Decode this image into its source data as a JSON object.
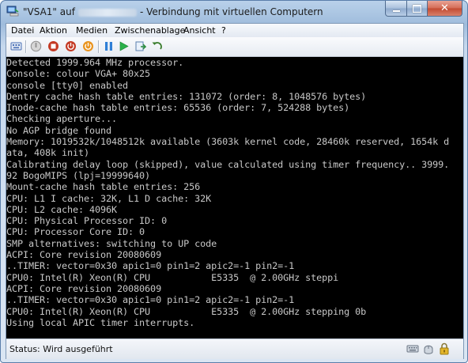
{
  "window": {
    "title_prefix": "\"VSA1\" auf",
    "title_suffix": "- Verbindung mit virtuellen Computern",
    "caption_close": "✕"
  },
  "menu": {
    "items": [
      "Datei",
      "Aktion",
      "Medien",
      "Zwischenablage",
      "Ansicht",
      "?"
    ]
  },
  "toolbar": {
    "buttons": [
      {
        "icon": "ctrl-alt-del-icon",
        "color": "#4a6fb5"
      },
      {
        "icon": "turn-off-icon",
        "color": "#8f8f8f"
      },
      {
        "icon": "shutdown-icon",
        "color": "#c43a24"
      },
      {
        "icon": "power-icon",
        "color": "#c43a24"
      },
      {
        "icon": "reset-icon",
        "color": "#e07b12"
      },
      {
        "icon": "pause-icon",
        "color": "#2f7fd6"
      },
      {
        "icon": "start-icon",
        "color": "#2bb04a"
      },
      {
        "icon": "snapshot-icon",
        "color": "#2a8d3a"
      },
      {
        "icon": "revert-icon",
        "color": "#3a7d2d"
      }
    ]
  },
  "console": {
    "lines": [
      "Detected 1999.964 MHz processor.",
      "Console: colour VGA+ 80x25",
      "console [tty0] enabled",
      "Dentry cache hash table entries: 131072 (order: 8, 1048576 bytes)",
      "Inode-cache hash table entries: 65536 (order: 7, 524288 bytes)",
      "Checking aperture...",
      "No AGP bridge found",
      "Memory: 1019532k/1048512k available (3603k kernel code, 28460k reserved, 1654k d",
      "ata, 408k init)",
      "Calibrating delay loop (skipped), value calculated using timer frequency.. 3999.",
      "92 BogoMIPS (lpj=19999640)",
      "Mount-cache hash table entries: 256",
      "CPU: L1 I cache: 32K, L1 D cache: 32K",
      "CPU: L2 cache: 4096K",
      "CPU: Physical Processor ID: 0",
      "CPU: Processor Core ID: 0",
      "SMP alternatives: switching to UP code",
      "ACPI: Core revision 20080609",
      "..TIMER: vector=0x30 apic1=0 pin1=2 apic2=-1 pin2=-1",
      "CPU0: Intel(R) Xeon(R) CPU           E5335  @ 2.00GHz steppi",
      "ACPI: Core revision 20080609",
      "..TIMER: vector=0x30 apic1=0 pin1=2 apic2=-1 pin2=-1",
      "CPU0: Intel(R) Xeon(R) CPU           E5335  @ 2.00GHz stepping 0b",
      "Using local APIC timer interrupts."
    ]
  },
  "status": {
    "label": "Status: Wird ausgeführt"
  }
}
